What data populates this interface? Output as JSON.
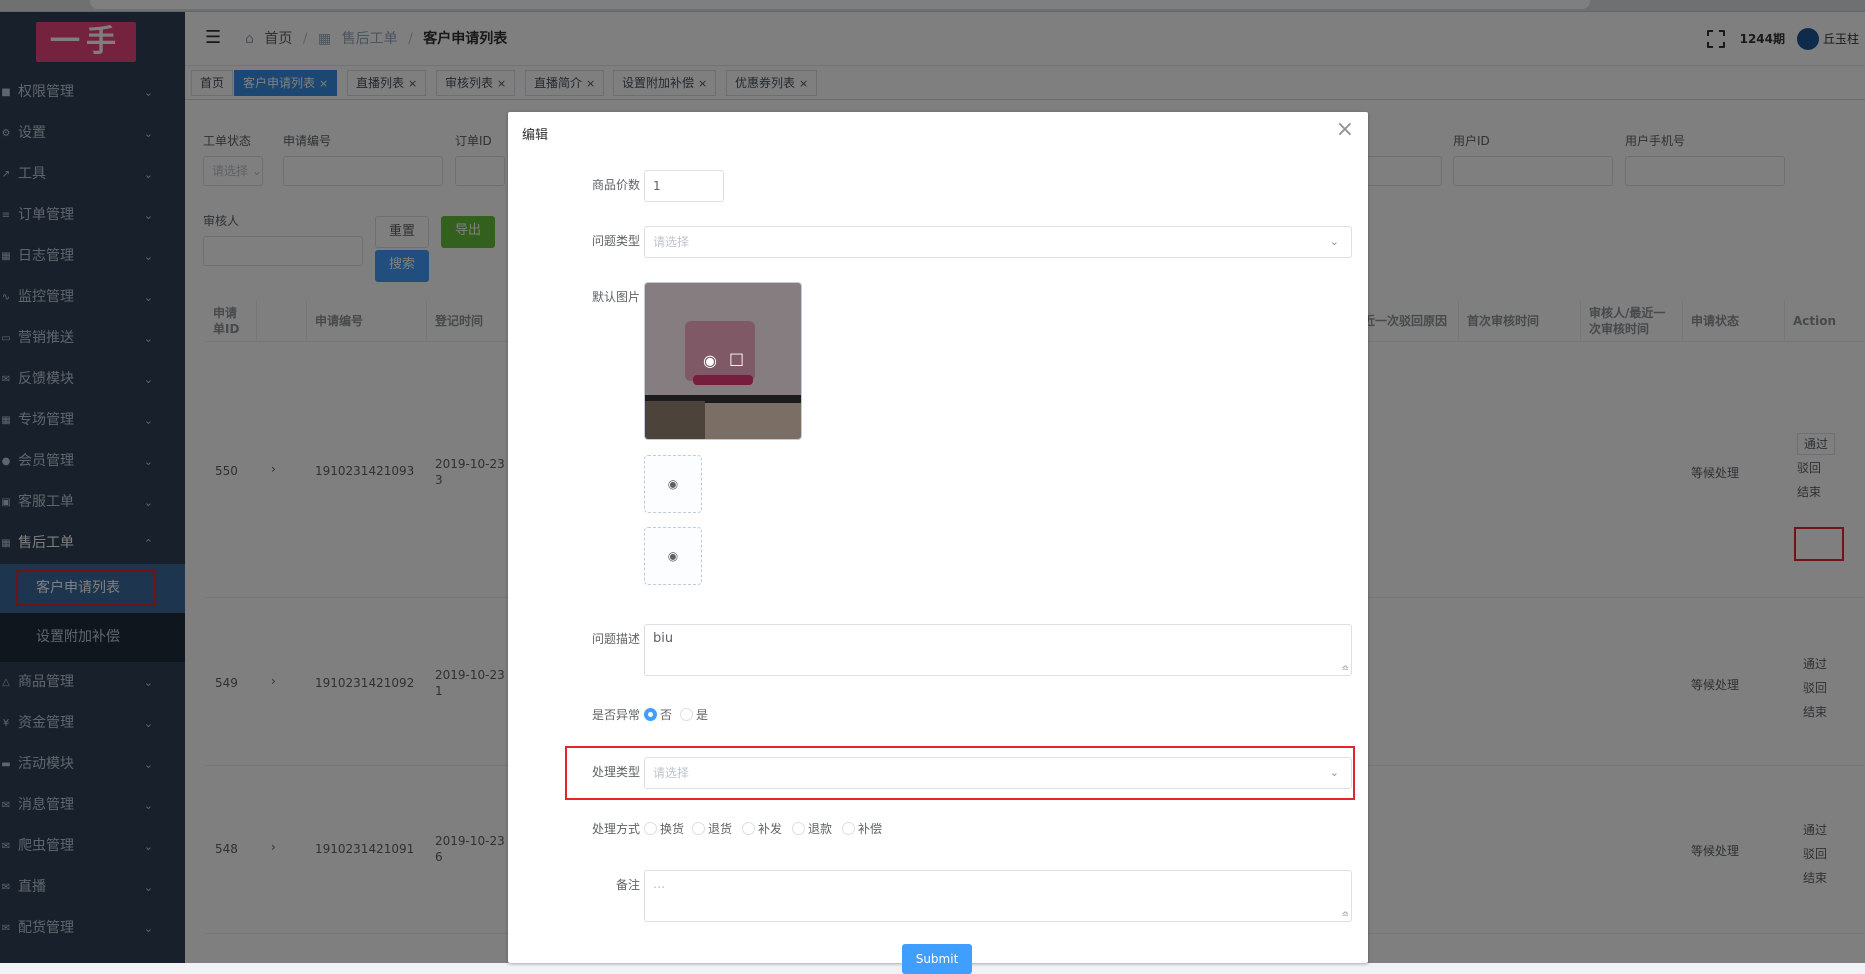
{
  "sidebar": {
    "logo": "一手",
    "items": [
      {
        "label": "权限管理",
        "icon": "lock-icon"
      },
      {
        "label": "设置",
        "icon": "gear-icon"
      },
      {
        "label": "工具",
        "icon": "wrench-icon"
      },
      {
        "label": "订单管理",
        "icon": "list-icon"
      },
      {
        "label": "日志管理",
        "icon": "doc-icon"
      },
      {
        "label": "监控管理",
        "icon": "pulse-icon"
      },
      {
        "label": "营销推送",
        "icon": "card-icon"
      },
      {
        "label": "反馈模块",
        "icon": "mail-icon"
      },
      {
        "label": "专场管理",
        "icon": "grid-icon"
      },
      {
        "label": "会员管理",
        "icon": "user-icon"
      },
      {
        "label": "客服工单",
        "icon": "chat-icon"
      },
      {
        "label": "售后工单",
        "icon": "ticket-icon",
        "expanded": true
      }
    ],
    "sub_items": [
      "客户申请列表",
      "设置附加补偿"
    ],
    "items_after": [
      {
        "label": "商品管理",
        "icon": "shirt-icon"
      },
      {
        "label": "资金管理",
        "icon": "yen-icon"
      },
      {
        "label": "活动模块",
        "icon": "car-icon"
      },
      {
        "label": "消息管理",
        "icon": "mail-icon"
      },
      {
        "label": "爬虫管理",
        "icon": "mail-icon"
      },
      {
        "label": "直播",
        "icon": "mail-icon"
      },
      {
        "label": "配货管理",
        "icon": "mail-icon"
      }
    ]
  },
  "navbar": {
    "breadcrumb": [
      "首页",
      "售后工单",
      "客户申请列表"
    ],
    "issue": "1244期",
    "username": "丘玉柱"
  },
  "tags": [
    {
      "label": "首页",
      "closable": false
    },
    {
      "label": "客户申请列表",
      "closable": true,
      "active": true
    },
    {
      "label": "直播列表",
      "closable": true
    },
    {
      "label": "审核列表",
      "closable": true
    },
    {
      "label": "直播简介",
      "closable": true
    },
    {
      "label": "设置附加补偿",
      "closable": true
    },
    {
      "label": "优惠券列表",
      "closable": true
    }
  ],
  "filters": {
    "labels": [
      "工单状态",
      "申请编号",
      "订单ID",
      "用户ID",
      "用户手机号",
      "审核人"
    ],
    "status_placeholder": "请选择",
    "reset": "重置",
    "export": "导出",
    "search": "搜索"
  },
  "table": {
    "headers": [
      "申请单ID",
      "申请编号",
      "登记时间",
      "近一次驳回原因",
      "首次审核时间",
      "审核人/最近一次审核时间",
      "申请状态",
      "Action"
    ],
    "rows": [
      {
        "id": "550",
        "no": "1910231421093",
        "time": "2019-10-23",
        "time2": "3",
        "status": "等候处理"
      },
      {
        "id": "549",
        "no": "1910231421092",
        "time": "2019-10-23",
        "time2": "1",
        "status": "等候处理"
      },
      {
        "id": "548",
        "no": "1910231421091",
        "time": "2019-10-23",
        "time2": "6",
        "status": "等候处理"
      }
    ],
    "actions": [
      "通过",
      "驳回",
      "结束"
    ]
  },
  "dialog": {
    "title": "编辑",
    "fields": {
      "count_label": "商品价数",
      "count_value": "1",
      "issue_type_label": "问题类型",
      "issue_type_placeholder": "请选择",
      "image_label": "默认图片",
      "desc_label": "问题描述",
      "desc_value": "biu",
      "abnormal_label": "是否异常",
      "abnormal_options": [
        "否",
        "是"
      ],
      "abnormal_selected": "否",
      "handle_type_label": "处理类型",
      "handle_type_placeholder": "请选择",
      "method_label": "处理方式",
      "method_options": [
        "换货",
        "退货",
        "补发",
        "退款",
        "补偿"
      ],
      "remark_label": "备注",
      "remark_placeholder": "..."
    },
    "submit": "Submit"
  }
}
